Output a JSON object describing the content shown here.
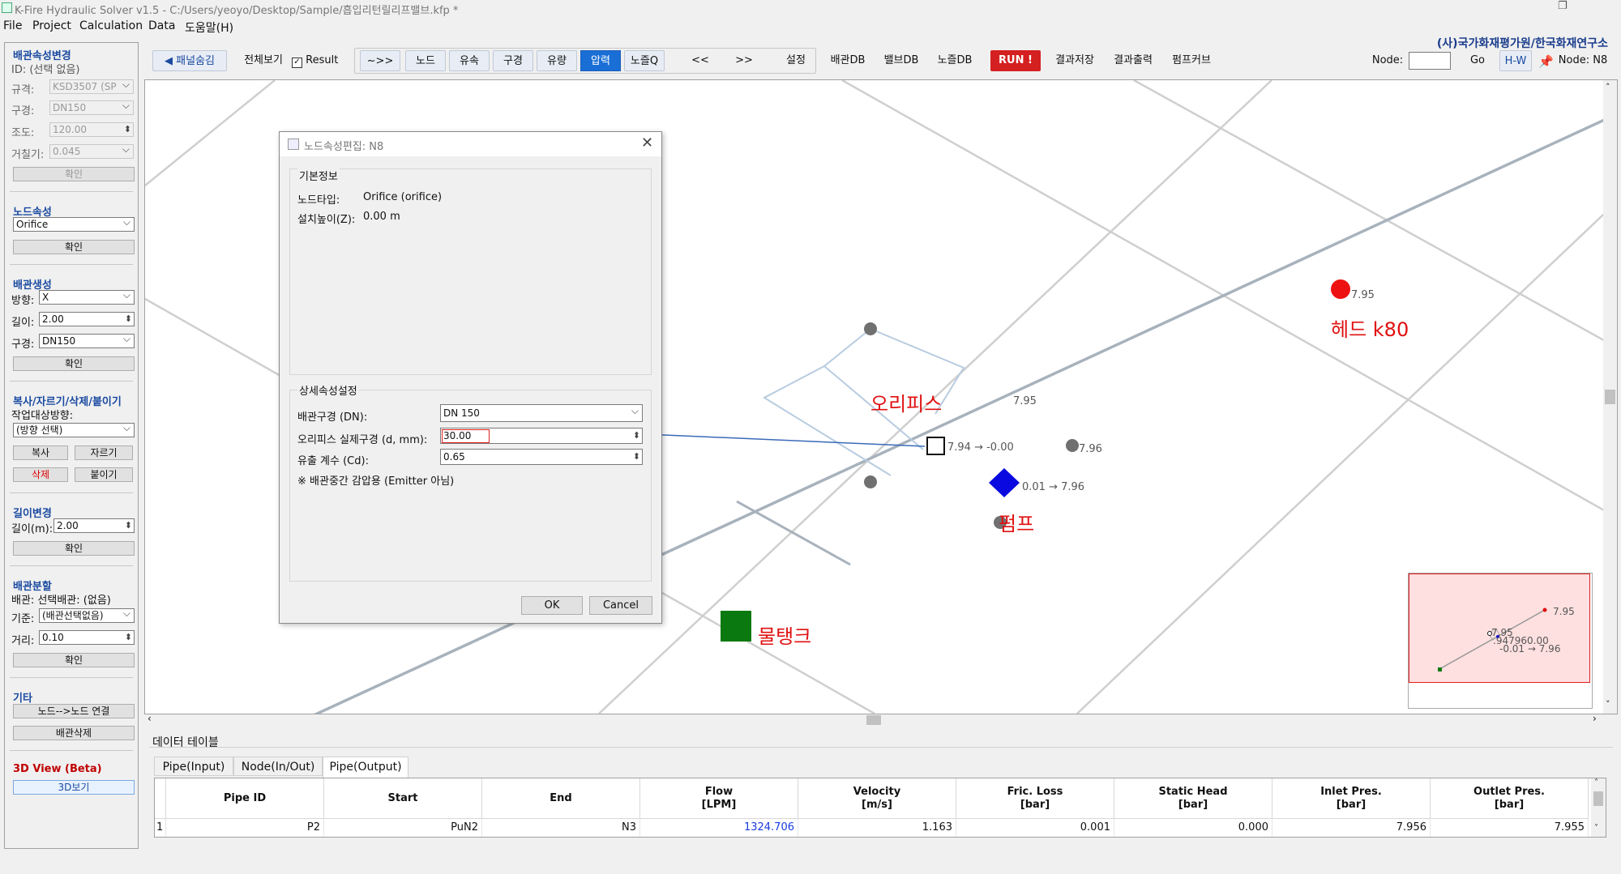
{
  "window": {
    "title": "K-Fire Hydraulic Solver v1.5 - C:/Users/yeoyo/Desktop/Sample/흡입리턴릴리프밸브.kfp *"
  },
  "menu": {
    "items": [
      "File",
      "Project",
      "Calculation",
      "Data",
      "도움말(H)"
    ],
    "org": "(사)국가화재평가원/한국화재연구소"
  },
  "left_panel": {
    "pipe_props": {
      "title": "배관속성변경",
      "id_text": "ID: (선택 없음)",
      "spec_label": "규격:",
      "spec_value": "KSD3507 (SP",
      "dia_label": "구경:",
      "dia_value": "DN150",
      "rough_label": "조도:",
      "rough_value": "120.00",
      "eps_label": "거칠기:",
      "eps_value": "0.045",
      "confirm": "확인"
    },
    "node_props": {
      "title": "노드속성",
      "type_value": "Orifice",
      "confirm": "확인"
    },
    "pipe_create": {
      "title": "배관생성",
      "dir_label": "방향:",
      "dir_value": "X",
      "len_label": "길이:",
      "len_value": "2.00",
      "dia_label": "구경:",
      "dia_value": "DN150",
      "confirm": "확인"
    },
    "copy": {
      "title": "복사/자르기/삭제/붙이기",
      "target_label": "작업대상방향:",
      "target_value": "(방향 선택)",
      "copy": "복사",
      "cut": "자르기",
      "delete": "삭제",
      "paste": "붙이기"
    },
    "length_change": {
      "title": "길이변경",
      "len_label": "길이(m):",
      "len_value": "2.00",
      "confirm": "확인"
    },
    "pipe_split": {
      "title": "배관분할",
      "pipe_text": "배관: 선택배관: (없음)",
      "base_label": "기준:",
      "base_value": "(배관선택없음)",
      "dist_label": "거리:",
      "dist_value": "0.10",
      "confirm": "확인"
    },
    "etc": {
      "title": "기타",
      "connect": "노드-->노드 연결",
      "delete_pipe": "배관삭제"
    },
    "view3d": {
      "title": "3D View (Beta)",
      "button": "3D보기"
    }
  },
  "toolbar": {
    "hide_panel": "◀ 패널숨김",
    "full_view": "전체보기",
    "result_label": "Result",
    "result_checked": true,
    "arrow": "~>>",
    "node": "노드",
    "velocity": "유속",
    "diameter": "구경",
    "flow": "유량",
    "pressure": "압력",
    "nozzle_q": "노즐Q",
    "prev": "<<",
    "next": ">>",
    "settings": "설정",
    "pipe_db": "배관DB",
    "valve_db": "밸브DB",
    "nozzle_db": "노즐DB",
    "run": "RUN !",
    "save_result": "결과저장",
    "print_result": "결과출력",
    "pump_curve": "펌프커브",
    "node_label": "Node:",
    "node_input": "",
    "go": "Go",
    "hw": "H-W",
    "node_display": "Node: N8"
  },
  "network": {
    "head_value": "7.95",
    "head_label": "헤드 k80",
    "orifice_label": "오리피스",
    "orifice_value": "7.94 → -0.00",
    "upper_node_value": "7.95",
    "right_node_value": "7.96",
    "pump_value": "0.01 → 7.96",
    "pump_label": "펌프",
    "tank_label": "물탱크",
    "minimap": {
      "v1": "7.95",
      "v2": "7.95",
      "v3": "-0.01 → 7.96",
      "v4": ".947960.00"
    }
  },
  "dialog": {
    "title": "노드속성편집: N8",
    "basic_title": "기본정보",
    "node_type_label": "노드타입:",
    "node_type_value": "Orifice (orifice)",
    "elev_label": "설치높이(Z):",
    "elev_value": "0.00 m",
    "detail_title": "상세속성설정",
    "pipe_dia_label": "배관구경 (DN):",
    "pipe_dia_value": "DN 150",
    "orifice_d_label": "오리피스 실제구경 (d, mm):",
    "orifice_d_value": "30.00",
    "cd_label": "유출 계수 (Cd):",
    "cd_value": "0.65",
    "note": "※ 배관중간 감압용 (Emitter 아님)",
    "ok": "OK",
    "cancel": "Cancel"
  },
  "data_table": {
    "title": "데이터 테이블",
    "tabs": [
      "Pipe(Input)",
      "Node(In/Out)",
      "Pipe(Output)"
    ],
    "headers": [
      "Pipe ID",
      "Start",
      "End",
      "Flow\n[LPM]",
      "Velocity\n[m/s]",
      "Fric. Loss\n[bar]",
      "Static Head\n[bar]",
      "Inlet Pres.\n[bar]",
      "Outlet Pres.\n[bar]"
    ],
    "rows": [
      {
        "index": "1",
        "pipe_id": "P2",
        "start": "PuN2",
        "end": "N3",
        "flow": "1324.706",
        "velocity": "1.163",
        "fric_loss": "0.001",
        "static_head": "0.000",
        "inlet": "7.956",
        "outlet": "7.955"
      }
    ]
  },
  "colors": {
    "accent": "#1a6fd6",
    "run": "#d42020",
    "head": "#ee1111",
    "pump": "#0a0ae0",
    "tank": "#0a7a10",
    "label_red": "#e01010"
  }
}
